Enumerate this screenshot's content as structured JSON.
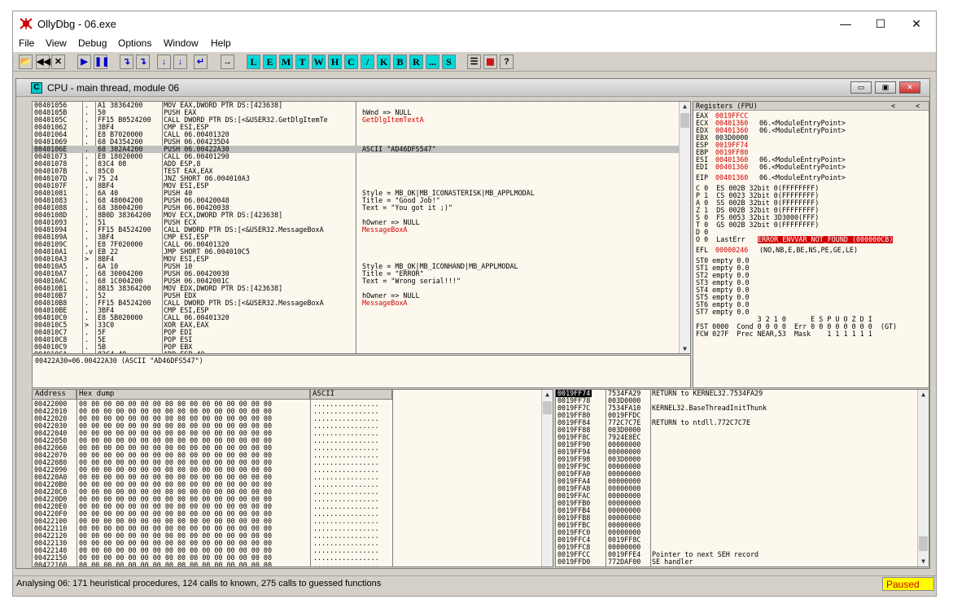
{
  "app": {
    "title": "OllyDbg - 06.exe",
    "window_controls": {
      "minimize": "—",
      "maximize": "☐",
      "close": "✕"
    }
  },
  "menu": [
    "File",
    "View",
    "Debug",
    "Options",
    "Window",
    "Help"
  ],
  "toolbar": {
    "buttons": [
      "📂",
      "◀◀",
      "✕",
      "▶",
      "❚❚",
      "↴",
      "↴",
      "↓",
      "↓",
      "↵",
      "→"
    ],
    "letters": [
      "L",
      "E",
      "M",
      "T",
      "W",
      "H",
      "C",
      "/",
      "K",
      "B",
      "R",
      "...",
      "S"
    ],
    "extras": [
      "☰",
      "▦",
      "?"
    ]
  },
  "cpu": {
    "icon": "C",
    "title": "CPU - main thread, module 06",
    "buttons": [
      "▭",
      "▣",
      "✕"
    ]
  },
  "disasm": {
    "rows": [
      {
        "addr": "00401056",
        "mark": ".",
        "hex": "A1 38364200",
        "asm": "MOV EAX,DWORD PTR DS:[423638]",
        "cmt": ""
      },
      {
        "addr": "0040105B",
        "mark": ".",
        "hex": "50",
        "asm": "PUSH EAX",
        "cmt": "hWnd => NULL"
      },
      {
        "addr": "0040105C",
        "mark": ".",
        "hex": "FF15 B0524200",
        "asm": "CALL DWORD PTR DS:[<&USER32.GetDlgItemTe",
        "cmt": "GetDlgItemTextA",
        "cmt_red": true
      },
      {
        "addr": "00401062",
        "mark": ".",
        "hex": "3BF4",
        "asm": "CMP ESI,ESP",
        "cmt": ""
      },
      {
        "addr": "00401064",
        "mark": ".",
        "hex": "E8 B7020000",
        "asm": "CALL 06.00401320",
        "cmt": ""
      },
      {
        "addr": "00401069",
        "mark": ".",
        "hex": "68 D4354200",
        "asm": "PUSH 06.004235D4",
        "cmt": ""
      },
      {
        "addr": "0040106E",
        "mark": ".",
        "hex": "68 302A4200",
        "asm": "PUSH 06.00422A30",
        "cmt": "ASCII \"AD46DFS547\"",
        "selected": true
      },
      {
        "addr": "00401073",
        "mark": ".",
        "hex": "E8 18020000",
        "asm": "CALL 06.00401290",
        "cmt": ""
      },
      {
        "addr": "00401078",
        "mark": ".",
        "hex": "83C4 08",
        "asm": "ADD ESP,8",
        "cmt": ""
      },
      {
        "addr": "0040107B",
        "mark": ".",
        "hex": "85C0",
        "asm": "TEST EAX,EAX",
        "cmt": ""
      },
      {
        "addr": "0040107D",
        "mark": ".v",
        "hex": "75 24",
        "asm": "JNZ SHORT 06.004010A3",
        "cmt": ""
      },
      {
        "addr": "0040107F",
        "mark": ".",
        "hex": "8BF4",
        "asm": "MOV ESI,ESP",
        "cmt": ""
      },
      {
        "addr": "00401081",
        "mark": ".",
        "hex": "6A 40",
        "asm": "PUSH 40",
        "cmt": "Style = MB_OK|MB_ICONASTERISK|MB_APPLMODAL"
      },
      {
        "addr": "00401083",
        "mark": ".",
        "hex": "68 48004200",
        "asm": "PUSH 06.00420048",
        "cmt": "Title = \"Good Job!\""
      },
      {
        "addr": "00401088",
        "mark": ".",
        "hex": "68 38004200",
        "asm": "PUSH 06.00420038",
        "cmt": "Text = \"You got it ;)\""
      },
      {
        "addr": "0040108D",
        "mark": ".",
        "hex": "8B0D 38364200",
        "asm": "MOV ECX,DWORD PTR DS:[423638]",
        "cmt": ""
      },
      {
        "addr": "00401093",
        "mark": ".",
        "hex": "51",
        "asm": "PUSH ECX",
        "cmt": "hOwner => NULL"
      },
      {
        "addr": "00401094",
        "mark": ".",
        "hex": "FF15 B4524200",
        "asm": "CALL DWORD PTR DS:[<&USER32.MessageBoxA",
        "cmt": "MessageBoxA",
        "cmt_red": true
      },
      {
        "addr": "0040109A",
        "mark": ".",
        "hex": "3BF4",
        "asm": "CMP ESI,ESP",
        "cmt": ""
      },
      {
        "addr": "0040109C",
        "mark": ".",
        "hex": "E8 7F020000",
        "asm": "CALL 06.00401320",
        "cmt": ""
      },
      {
        "addr": "004010A1",
        "mark": ".v",
        "hex": "EB 22",
        "asm": "JMP SHORT 06.004010C5",
        "cmt": ""
      },
      {
        "addr": "004010A3",
        "mark": ">",
        "hex": "8BF4",
        "asm": "MOV ESI,ESP",
        "cmt": ""
      },
      {
        "addr": "004010A5",
        "mark": ".",
        "hex": "6A 10",
        "asm": "PUSH 10",
        "cmt": "Style = MB_OK|MB_ICONHAND|MB_APPLMODAL"
      },
      {
        "addr": "004010A7",
        "mark": ".",
        "hex": "68 30004200",
        "asm": "PUSH 06.00420030",
        "cmt": "Title = \"ERROR\""
      },
      {
        "addr": "004010AC",
        "mark": ".",
        "hex": "68 1C004200",
        "asm": "PUSH 06.0042001C",
        "cmt": "Text = \"Wrong serial!!!\""
      },
      {
        "addr": "004010B1",
        "mark": ".",
        "hex": "8B15 38364200",
        "asm": "MOV EDX,DWORD PTR DS:[423638]",
        "cmt": ""
      },
      {
        "addr": "004010B7",
        "mark": ".",
        "hex": "52",
        "asm": "PUSH EDX",
        "cmt": "hOwner => NULL"
      },
      {
        "addr": "004010B8",
        "mark": ".",
        "hex": "FF15 B4524200",
        "asm": "CALL DWORD PTR DS:[<&USER32.MessageBoxA",
        "cmt": "MessageBoxA",
        "cmt_red": true
      },
      {
        "addr": "004010BE",
        "mark": ".",
        "hex": "3BF4",
        "asm": "CMP ESI,ESP",
        "cmt": ""
      },
      {
        "addr": "004010C0",
        "mark": ".",
        "hex": "E8 5B020000",
        "asm": "CALL 06.00401320",
        "cmt": ""
      },
      {
        "addr": "004010C5",
        "mark": ">",
        "hex": "33C0",
        "asm": "XOR EAX,EAX",
        "cmt": ""
      },
      {
        "addr": "004010C7",
        "mark": ".",
        "hex": "5F",
        "asm": "POP EDI",
        "cmt": ""
      },
      {
        "addr": "004010C8",
        "mark": ".",
        "hex": "5E",
        "asm": "POP ESI",
        "cmt": ""
      },
      {
        "addr": "004010C9",
        "mark": ".",
        "hex": "5B",
        "asm": "POP EBX",
        "cmt": ""
      },
      {
        "addr": "004010CA",
        "mark": ".",
        "hex": "83C4 40",
        "asm": "ADD ESP,40",
        "cmt": ""
      }
    ]
  },
  "info_line": "00422A30=06.00422A30 (ASCII \"AD46DFS547\")",
  "registers": {
    "header": "Registers (FPU)",
    "header_arrows": [
      "<",
      "<"
    ],
    "gp": [
      {
        "name": "EAX",
        "value": "0019FFCC",
        "note": "",
        "red": true
      },
      {
        "name": "ECX",
        "value": "00401360",
        "note": "06.<ModuleEntryPoint>",
        "red": true
      },
      {
        "name": "EDX",
        "value": "00401360",
        "note": "06.<ModuleEntryPoint>",
        "red": true
      },
      {
        "name": "EBX",
        "value": "003D0000",
        "note": "",
        "red": false
      },
      {
        "name": "ESP",
        "value": "0019FF74",
        "note": "",
        "red": true
      },
      {
        "name": "EBP",
        "value": "0019FF80",
        "note": "",
        "red": true
      },
      {
        "name": "ESI",
        "value": "00401360",
        "note": "06.<ModuleEntryPoint>",
        "red": true
      },
      {
        "name": "EDI",
        "value": "00401360",
        "note": "06.<ModuleEntryPoint>",
        "red": true
      }
    ],
    "eip": {
      "name": "EIP",
      "value": "00401360",
      "note": "06.<ModuleEntryPoint>"
    },
    "flags": [
      "C 0  ES 002B 32bit 0(FFFFFFFF)",
      "P 1  CS 0023 32bit 0(FFFFFFFF)",
      "A 0  SS 002B 32bit 0(FFFFFFFF)",
      "Z 1  DS 002B 32bit 0(FFFFFFFF)",
      "S 0  FS 0053 32bit 3D3000(FFF)",
      "T 0  GS 002B 32bit 0(FFFFFFFF)",
      "D 0"
    ],
    "lasterr_prefix": "O 0  LastErr",
    "lasterr_value": "ERROR_ENVVAR_NOT_FOUND (000000CB)",
    "efl_prefix": "EFL",
    "efl_value": "00000246",
    "efl_note": "(NO,NB,E,BE,NS,PE,GE,LE)",
    "fpu": [
      "ST0 empty 0.0",
      "ST1 empty 0.0",
      "ST2 empty 0.0",
      "ST3 empty 0.0",
      "ST4 empty 0.0",
      "ST5 empty 0.0",
      "ST6 empty 0.0",
      "ST7 empty 0.0",
      "               3 2 1 0      E S P U O Z D I",
      "FST 0000  Cond 0 0 0 0  Err 0 0 0 0 0 0 0 0  (GT)",
      "FCW 027F  Prec NEAR,53  Mask    1 1 1 1 1 1"
    ]
  },
  "dump": {
    "headers": {
      "address": "Address",
      "hex": "Hex dump",
      "ascii": "ASCII"
    },
    "addresses": [
      "00422000",
      "00422010",
      "00422020",
      "00422030",
      "00422040",
      "00422050",
      "00422060",
      "00422070",
      "00422080",
      "00422090",
      "004220A0",
      "004220B0",
      "004220C0",
      "004220D0",
      "004220E0",
      "004220F0",
      "00422100",
      "00422110",
      "00422120",
      "00422130",
      "00422140",
      "00422150",
      "00422160"
    ],
    "hex_line": "00 00 00 00 00 00 00 00 00 00 00 00 00 00 00 00",
    "ascii_line": "................"
  },
  "stack": {
    "rows": [
      {
        "addr": "0019FF74",
        "val": "7534FA29",
        "cmt": "RETURN to KERNEL32.7534FA29",
        "selected": true
      },
      {
        "addr": "0019FF78",
        "val": "003D0000",
        "cmt": ""
      },
      {
        "addr": "0019FF7C",
        "val": "7534FA10",
        "cmt": "KERNEL32.BaseThreadInitThunk"
      },
      {
        "addr": "0019FF80",
        "val": "0019FFDC",
        "cmt": ""
      },
      {
        "addr": "0019FF84",
        "val": "772C7C7E",
        "cmt": "RETURN to ntdll.772C7C7E"
      },
      {
        "addr": "0019FF88",
        "val": "003D0000",
        "cmt": ""
      },
      {
        "addr": "0019FF8C",
        "val": "7924E8EC",
        "cmt": ""
      },
      {
        "addr": "0019FF90",
        "val": "00000000",
        "cmt": ""
      },
      {
        "addr": "0019FF94",
        "val": "00000000",
        "cmt": ""
      },
      {
        "addr": "0019FF98",
        "val": "003D0000",
        "cmt": ""
      },
      {
        "addr": "0019FF9C",
        "val": "00000000",
        "cmt": ""
      },
      {
        "addr": "0019FFA0",
        "val": "00000000",
        "cmt": ""
      },
      {
        "addr": "0019FFA4",
        "val": "00000000",
        "cmt": ""
      },
      {
        "addr": "0019FFA8",
        "val": "00000000",
        "cmt": ""
      },
      {
        "addr": "0019FFAC",
        "val": "00000000",
        "cmt": ""
      },
      {
        "addr": "0019FFB0",
        "val": "00000000",
        "cmt": ""
      },
      {
        "addr": "0019FFB4",
        "val": "00000000",
        "cmt": ""
      },
      {
        "addr": "0019FFB8",
        "val": "00000000",
        "cmt": ""
      },
      {
        "addr": "0019FFBC",
        "val": "00000000",
        "cmt": ""
      },
      {
        "addr": "0019FFC0",
        "val": "00000000",
        "cmt": ""
      },
      {
        "addr": "0019FFC4",
        "val": "0019FF8C",
        "cmt": ""
      },
      {
        "addr": "0019FFC8",
        "val": "00000000",
        "cmt": ""
      },
      {
        "addr": "0019FFCC",
        "val": "0019FFE4",
        "cmt": "Pointer to next SEH record"
      },
      {
        "addr": "0019FFD0",
        "val": "772DAF00",
        "cmt": "SE handler"
      }
    ]
  },
  "status": {
    "text": "Analysing 06: 171 heuristical procedures, 124 calls to known, 275 calls to guessed functions",
    "state": "Paused"
  },
  "colors": {
    "accent_red": "#d00000",
    "pane_bg": "#fdf8ee",
    "paused_bg": "#ffff00",
    "letter_btn": "#00d8d8"
  }
}
